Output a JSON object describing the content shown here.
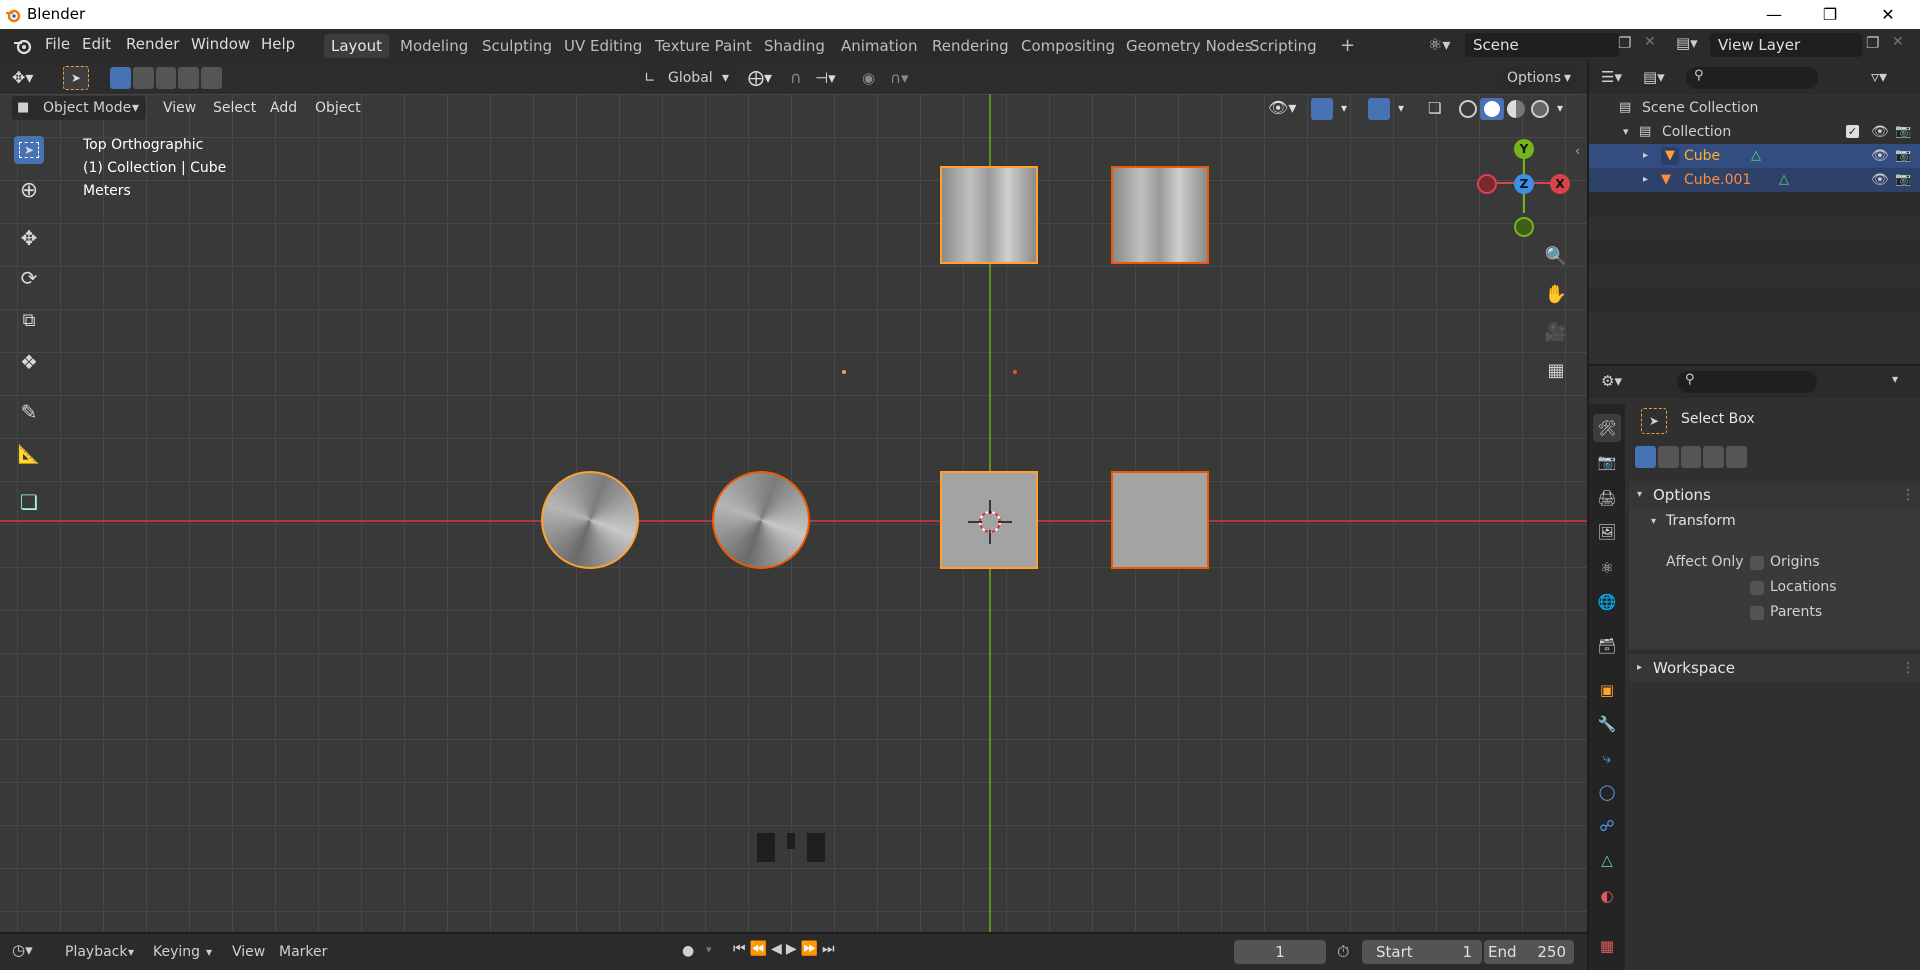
{
  "window": {
    "title": "Blender"
  },
  "menu": [
    "File",
    "Edit",
    "Render",
    "Window",
    "Help"
  ],
  "workspaces": [
    "Layout",
    "Modeling",
    "Sculpting",
    "UV Editing",
    "Texture Paint",
    "Shading",
    "Animation",
    "Rendering",
    "Compositing",
    "Geometry Nodes",
    "Scripting"
  ],
  "workspace_add": "+",
  "scene": {
    "name": "Scene"
  },
  "view_layer": {
    "name": "View Layer"
  },
  "viewport_header": {
    "orientation": "Global",
    "options_label": "Options",
    "mode": "Object Mode",
    "menus": [
      "View",
      "Select",
      "Add",
      "Object"
    ]
  },
  "overlay_text": {
    "view_name": "Top Orthographic",
    "collection_info": "(1) Collection | Cube",
    "units": "Meters"
  },
  "gizmo": {
    "x": "X",
    "y": "Y",
    "z": "Z"
  },
  "outliner": {
    "root": "Scene Collection",
    "collection": "Collection",
    "objects": [
      "Cube",
      "Cube.001"
    ]
  },
  "properties": {
    "tool_name": "Select Box",
    "options_header": "Options",
    "transform_header": "Transform",
    "affect_only_label": "Affect Only",
    "affect_only": [
      "Origins",
      "Locations",
      "Parents"
    ],
    "workspace_header": "Workspace"
  },
  "timeline": {
    "menus": [
      "Playback",
      "Keying",
      "View",
      "Marker"
    ],
    "current_frame": "1",
    "start_label": "Start",
    "start": "1",
    "end_label": "End",
    "end": "250"
  },
  "colors": {
    "accent_blue": "#4772b3",
    "active_orange": "#ffa030",
    "selected_orange": "#f15800",
    "axis_x": "#d9434c",
    "axis_y": "#75b31d",
    "axis_z": "#3a8fe8"
  }
}
